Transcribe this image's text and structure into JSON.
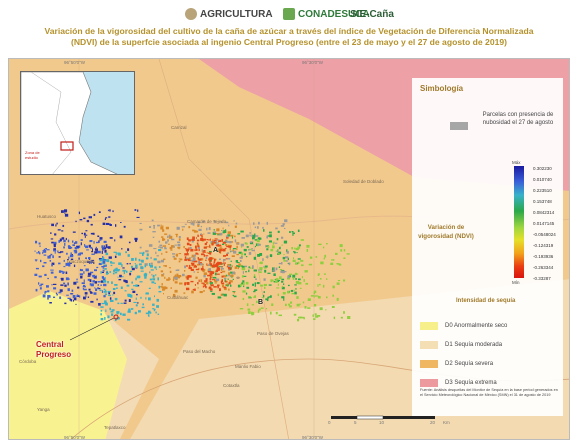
{
  "header": {
    "logos": [
      "AGRICULTURA",
      "CONADESUCA",
      "SIE-Caña"
    ],
    "title_line1": "Variación de la vigorosidad del cultivo de la caña de azúcar a través del índice de Vegetación de Diferencia Normalizada",
    "title_line2": "(NDVI) de la superfcie asociada al ingenio Central Progreso (entre el 23 de mayo y el 27 de agosto de 2019)"
  },
  "map": {
    "coords_top": [
      "96°50'0\"W",
      "96°30'0\"W"
    ],
    "coords_bottom": [
      "96°50'0\"W",
      "96°30'0\"W"
    ],
    "places": [
      "Carrizal",
      "Soledad de Doblado",
      "Paso de Ovejas",
      "Huatusco",
      "Ixtaczoquitlán",
      "Camarón de Tejeda",
      "Cuitláhuac",
      "Paso del Macho",
      "Manlio Fabio",
      "Cotaxtla",
      "Yanga",
      "Tepatlaxco",
      "Córdoba"
    ],
    "inset_label": "Zona de\nestudio",
    "central_label_1": "Central",
    "central_label_2": "Progreso",
    "letters": [
      "A",
      "B"
    ],
    "scale_labels": [
      "0",
      "5",
      "10",
      "20",
      "Km"
    ]
  },
  "legend": {
    "title": "Simbología",
    "cloud_label": "Parcelas con presencia de nubosidad el 27 de agosto",
    "ndvi_title": "Variación de vigorosidad (NDVI)",
    "ndvi_max": "Máx",
    "ndvi_min": "Mín",
    "ndvi_ticks": [
      "0.302230",
      "0.010740",
      "0.223510",
      "0.153748",
      "0.0842314",
      "0.0147145",
      "-0.0548024",
      "-0.124319",
      "-0.193936",
      "-0.263344",
      "-0.33287"
    ],
    "drought_title": "Intensidad de sequía",
    "drought": [
      {
        "label": "D0 Anormalmente seco",
        "color": "#f7f08a"
      },
      {
        "label": "D1 Sequía moderada",
        "color": "#f4dfb4"
      },
      {
        "label": "D2 Sequía severa",
        "color": "#efb762"
      },
      {
        "label": "D3 Sequía extrema",
        "color": "#ec9a9e"
      }
    ],
    "source": "Fuente: Análisis drsquellas del Monitor de Sequía en la base period generados en el Servicio Meteorológico Nacional de México (SMN) el 31 de agosto de 2019"
  },
  "colors": {
    "title": "#b5922c",
    "cloud": "#a6a6a6",
    "central": "#c21d18"
  }
}
